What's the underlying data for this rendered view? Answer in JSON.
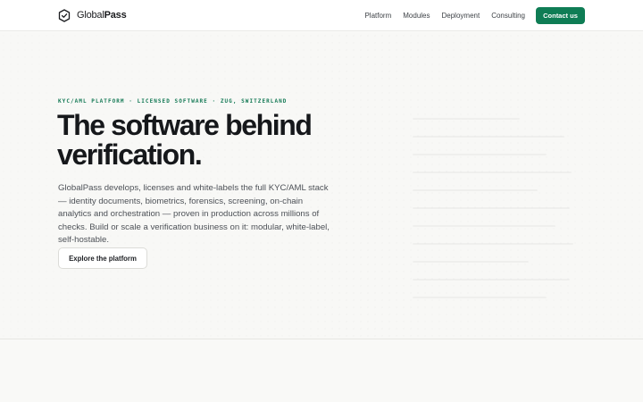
{
  "header": {
    "brand": {
      "name_part1": "Global",
      "name_part2": "Pass",
      "logo_icon": "shield-check-icon"
    },
    "nav": [
      {
        "label": "Platform"
      },
      {
        "label": "Modules"
      },
      {
        "label": "Deployment"
      },
      {
        "label": "Consulting"
      }
    ],
    "cta_label": "Contact us"
  },
  "hero": {
    "eyebrow": "KYC/AML PLATFORM · LICENSED SOFTWARE · ZUG, SWITZERLAND",
    "headline_line1": "The software behind",
    "headline_line2": "verification.",
    "lede": "GlobalPass develops, licenses and white-labels the full KYC/AML stack — identity documents, biometrics, forensics, screening, on-chain analytics and orchestration — proven in production across millions of checks. Build or scale a verification business on it: modular, white-label, self-hostable.",
    "cta_label": "Explore the platform"
  },
  "colors": {
    "accent": "#0f7d55",
    "eyebrow": "#157a56",
    "headline": "#16181b",
    "body": "#4d5157",
    "background": "#f8f8f6"
  }
}
